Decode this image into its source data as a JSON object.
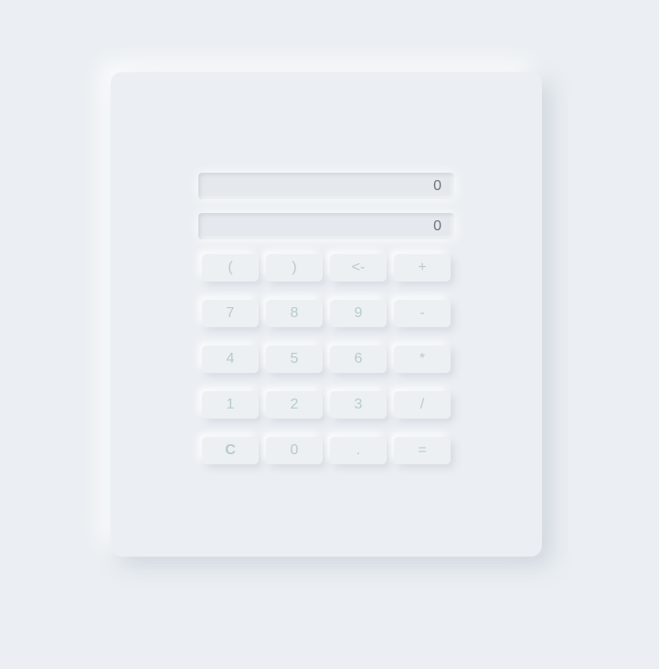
{
  "calculator": {
    "expression_display": "0",
    "result_display": "0",
    "keys": [
      [
        "(",
        ")",
        "<-",
        "+"
      ],
      [
        "7",
        "8",
        "9",
        "-"
      ],
      [
        "4",
        "5",
        "6",
        "*"
      ],
      [
        "1",
        "2",
        "3",
        "/"
      ],
      [
        "C",
        "0",
        ".",
        "="
      ]
    ]
  },
  "colors": {
    "background": "#ebeff3",
    "display_text": "#6f7378",
    "key_text": "#b9cbc8"
  }
}
